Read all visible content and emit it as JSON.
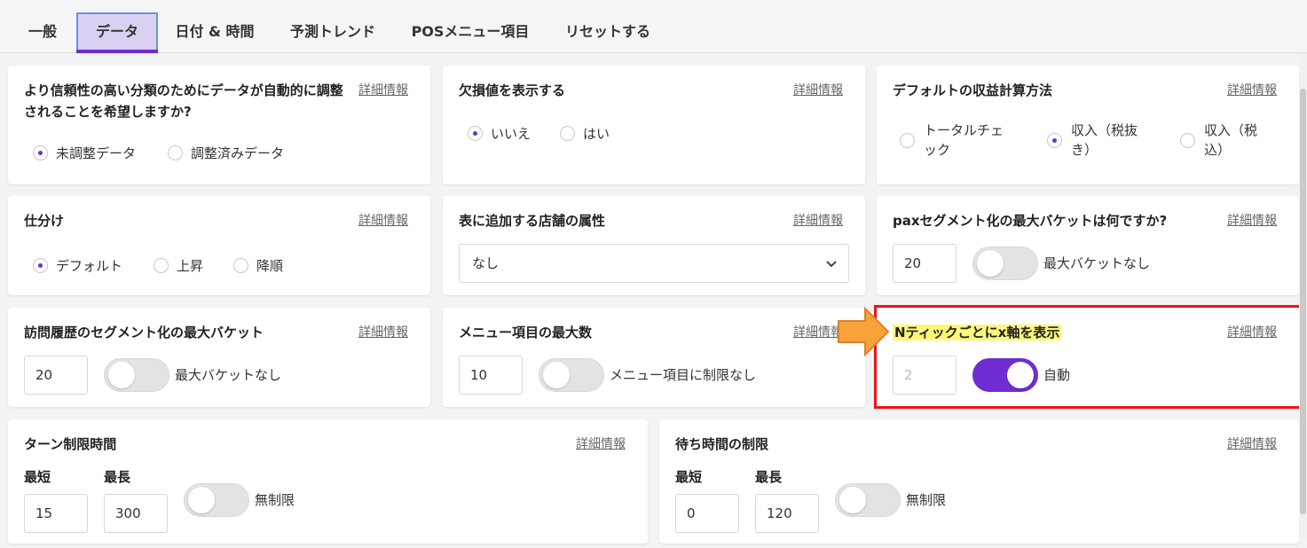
{
  "tabs": [
    {
      "label": "一般"
    },
    {
      "label": "データ"
    },
    {
      "label": "日付 & 時間"
    },
    {
      "label": "予測トレンド"
    },
    {
      "label": "POSメニュー項目"
    },
    {
      "label": "リセットする"
    }
  ],
  "detail_label": "詳細情報",
  "cards": {
    "auto_adjust": {
      "title": "より信頼性の高い分類のためにデータが自動的に調整されることを希望しますか?",
      "options": [
        "未調整データ",
        "調整済みデータ"
      ],
      "selected": "未調整データ"
    },
    "show_missing": {
      "title": "欠損値を表示する",
      "options": [
        "いいえ",
        "はい"
      ],
      "selected": "いいえ"
    },
    "revenue_method": {
      "title": "デフォルトの収益計算方法",
      "options": [
        "トータルチェック",
        "収入（税抜き）",
        "収入（税込）"
      ],
      "selected": "収入（税抜き）"
    },
    "sort": {
      "title": "仕分け",
      "options": [
        "デフォルト",
        "上昇",
        "降順"
      ],
      "selected": "デフォルト"
    },
    "store_attr": {
      "title": "表に追加する店舗の属性",
      "value": "なし"
    },
    "pax_segment": {
      "title": "paxセグメント化の最大バケットは何ですか?",
      "value": "20",
      "toggle_label": "最大バケットなし"
    },
    "visit_segment": {
      "title": "訪問履歴のセグメント化の最大バケット",
      "value": "20",
      "toggle_label": "最大バケットなし"
    },
    "menu_max": {
      "title": "メニュー項目の最大数",
      "value": "10",
      "toggle_label": "メニュー項目に制限なし"
    },
    "x_axis": {
      "title": "Nティックごとにx軸を表示",
      "value": "2",
      "toggle_label": "自動"
    },
    "turn_limit": {
      "title": "ターン制限時間",
      "min_label": "最短",
      "max_label": "最長",
      "min_value": "15",
      "max_value": "300",
      "toggle_label": "無制限"
    },
    "wait_limit": {
      "title": "待ち時間の制限",
      "min_label": "最短",
      "max_label": "最長",
      "min_value": "0",
      "max_value": "120",
      "toggle_label": "無制限"
    }
  },
  "colors": {
    "accent": "#6f2dd2",
    "highlight_box": "#e8131b",
    "highlight_text": "#fbf77a",
    "arrow": "#f7a23a"
  }
}
